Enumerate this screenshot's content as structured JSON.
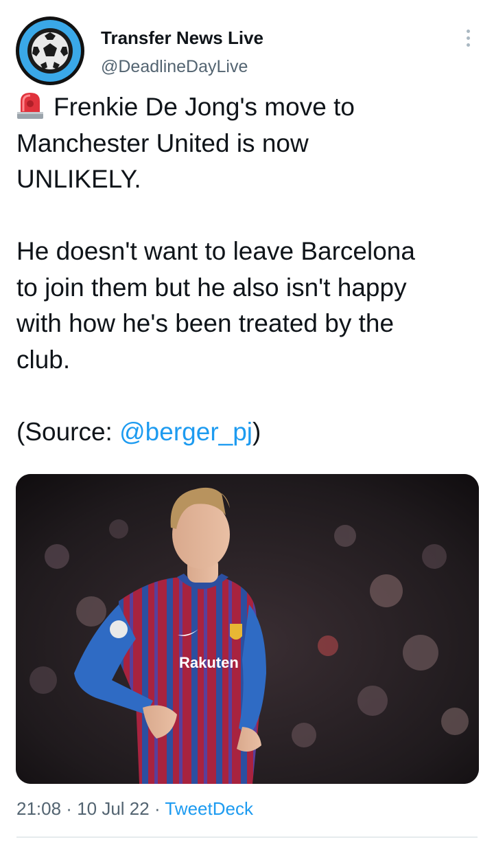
{
  "author": {
    "name": "Transfer News Live",
    "handle": "@DeadlineDayLive",
    "avatar_icon": "soccer-ball-icon"
  },
  "tweet": {
    "line1_text": "Frenkie De Jong's move to",
    "line2": "Manchester United is now",
    "line3": "UNLIKELY.",
    "para2": [
      "He doesn't want to leave Barcelona",
      "to join them but he also isn't happy",
      "with how he's been treated by the",
      "club."
    ],
    "source_prefix": "(Source: ",
    "source_mention": "@berger_pj",
    "source_suffix": ")",
    "leading_emoji": "rotating-light-icon"
  },
  "media": {
    "jersey_text": "Rakuten"
  },
  "meta": {
    "time": "21:08",
    "sep1": " · ",
    "date": "10 Jul 22",
    "sep2": " · ",
    "client": "TweetDeck"
  },
  "colors": {
    "link": "#1d9bf0",
    "secondary": "#536471",
    "avatar_ring": "#3aa8e8"
  }
}
